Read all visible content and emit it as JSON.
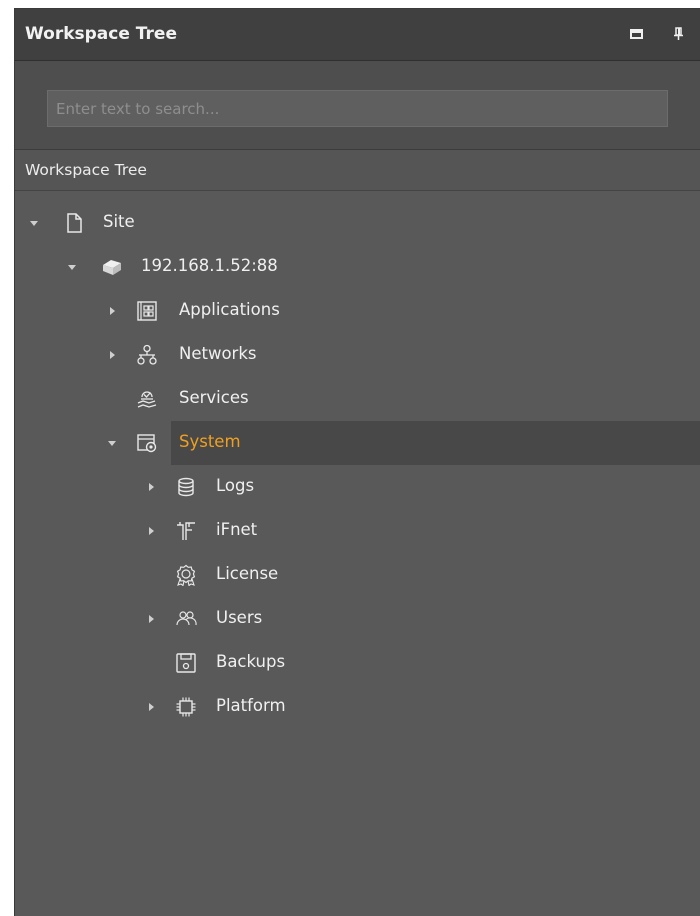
{
  "panel": {
    "title": "Workspace Tree",
    "maximize_icon": "maximize-icon",
    "pin_icon": "pin-icon"
  },
  "search": {
    "placeholder": "Enter text to search...",
    "value": ""
  },
  "section": {
    "title": "Workspace Tree"
  },
  "tree": {
    "site": {
      "label": "Site",
      "icon": "document-icon",
      "expanded": true
    },
    "server": {
      "label": "192.168.1.52:88",
      "icon": "server-icon",
      "expanded": true
    },
    "applications": {
      "label": "Applications",
      "icon": "applications-icon",
      "expanded": false
    },
    "networks": {
      "label": "Networks",
      "icon": "network-icon",
      "expanded": false
    },
    "services": {
      "label": "Services",
      "icon": "services-icon"
    },
    "system": {
      "label": "System",
      "icon": "system-settings-icon",
      "expanded": true,
      "selected": true
    },
    "logs": {
      "label": "Logs",
      "icon": "database-icon",
      "expanded": false
    },
    "ifnet": {
      "label": "iFnet",
      "icon": "ifnet-icon",
      "expanded": false
    },
    "license": {
      "label": "License",
      "icon": "license-icon"
    },
    "users": {
      "label": "Users",
      "icon": "users-icon",
      "expanded": false
    },
    "backups": {
      "label": "Backups",
      "icon": "backup-icon"
    },
    "platform": {
      "label": "Platform",
      "icon": "chip-icon",
      "expanded": false
    }
  },
  "colors": {
    "selected_text": "#f0a020",
    "panel_bg": "#595959",
    "titlebar_bg": "#404040"
  }
}
